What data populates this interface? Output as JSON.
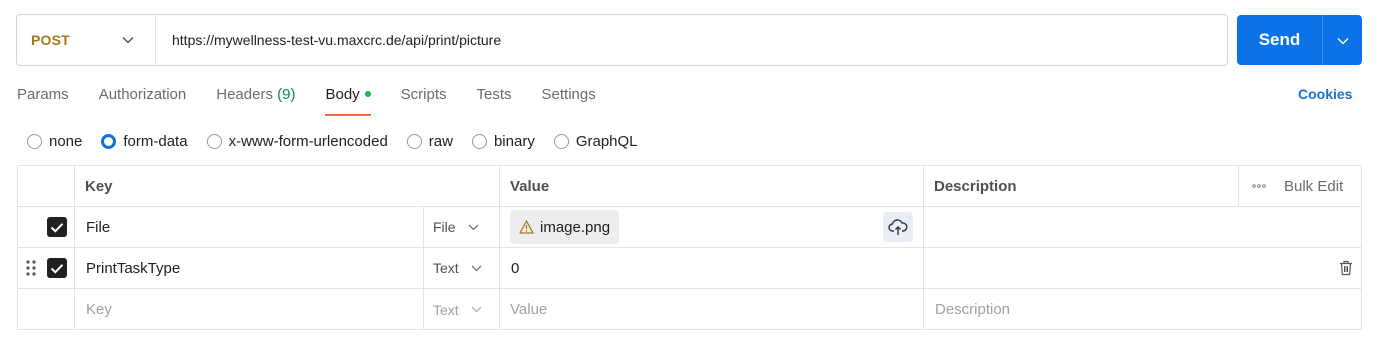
{
  "request": {
    "method": "POST",
    "url": "https://mywellness-test-vu.maxcrc.de/api/print/picture",
    "send_label": "Send"
  },
  "tabs": [
    {
      "label": "Params"
    },
    {
      "label": "Authorization"
    },
    {
      "label": "Headers",
      "count": "(9)"
    },
    {
      "label": "Body"
    },
    {
      "label": "Scripts"
    },
    {
      "label": "Tests"
    },
    {
      "label": "Settings"
    }
  ],
  "cookies_label": "Cookies",
  "body_types": [
    "none",
    "form-data",
    "x-www-form-urlencoded",
    "raw",
    "binary",
    "GraphQL"
  ],
  "selected_body_type": "form-data",
  "table": {
    "headers": {
      "key": "Key",
      "value": "Value",
      "description": "Description",
      "bulk_edit": "Bulk Edit"
    },
    "rows": [
      {
        "checked": true,
        "key": "File",
        "type": "File",
        "value": "image.png",
        "description": ""
      },
      {
        "checked": true,
        "key": "PrintTaskType",
        "type": "Text",
        "value": "0",
        "description": ""
      }
    ],
    "placeholder": {
      "key": "Key",
      "type": "Text",
      "value": "Value",
      "description": "Description"
    }
  },
  "colors": {
    "method": "#a27b17",
    "send": "#0b72e7",
    "active_tab_underline": "#f26b3a",
    "body_dot": "#0cbb52",
    "headers_count": "#0a8a4a",
    "link": "#1a73c8"
  },
  "icons": [
    "chevron-down-icon",
    "warning-icon",
    "cloud-upload-icon",
    "drag-handle-icon",
    "trash-icon",
    "ellipsis-icon",
    "check-icon"
  ]
}
